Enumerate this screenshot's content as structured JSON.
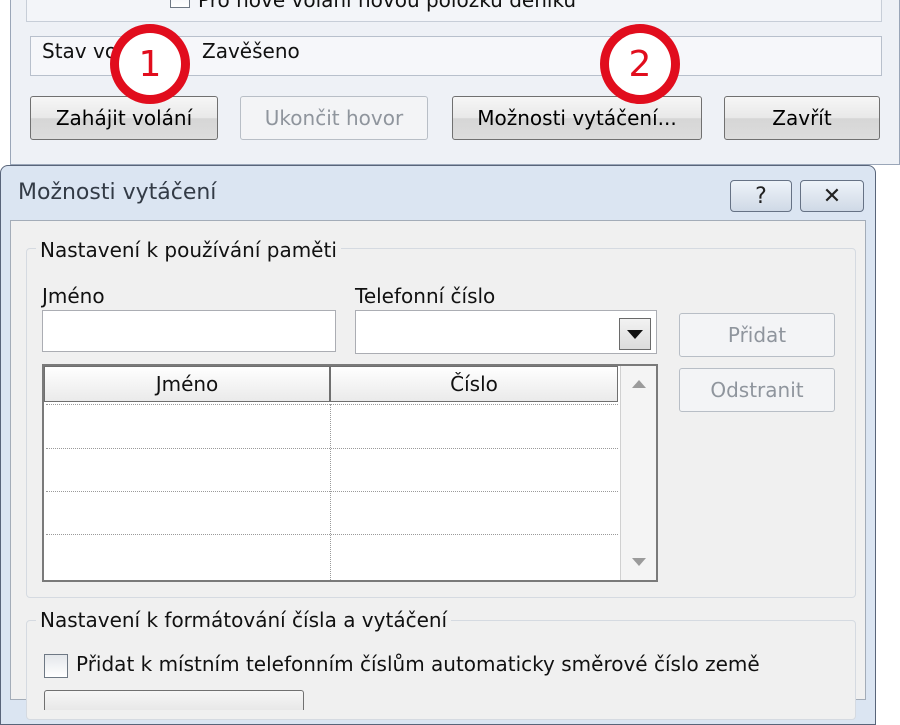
{
  "background_window": {
    "new_entry_checkbox_label": "Pro nové volání novou položku deníku",
    "status_label": "Stav volání",
    "status_value": "Zavěšeno",
    "buttons": {
      "start_call": "Zahájit volání",
      "end_call": "Ukončit hovor",
      "dialing_options": "Možnosti vytáčení...",
      "close": "Zavřít"
    },
    "step_markers": [
      "1",
      "2"
    ]
  },
  "dialog": {
    "title": "Možnosti vytáčení",
    "help_glyph": "?",
    "close_glyph": "✕",
    "memory_group": {
      "title": "Nastavení k používání paměti",
      "name_label": "Jméno",
      "phone_label": "Telefonní číslo",
      "name_value": "",
      "phone_value": "",
      "add_button": "Přidat",
      "remove_button": "Odstranit",
      "list_columns": [
        "Jméno",
        "Číslo"
      ],
      "list_rows": []
    },
    "format_group": {
      "title": "Nastavení k formátování čísla a vytáčení",
      "country_code_checkbox_label": "Přidat k místním telefonním číslům automaticky směrové číslo země",
      "country_code_checked": false
    }
  },
  "colors": {
    "marker_red": "#e10d1d",
    "dialog_frame": "#dbe5f2",
    "body_bg": "#f0f0f0"
  }
}
